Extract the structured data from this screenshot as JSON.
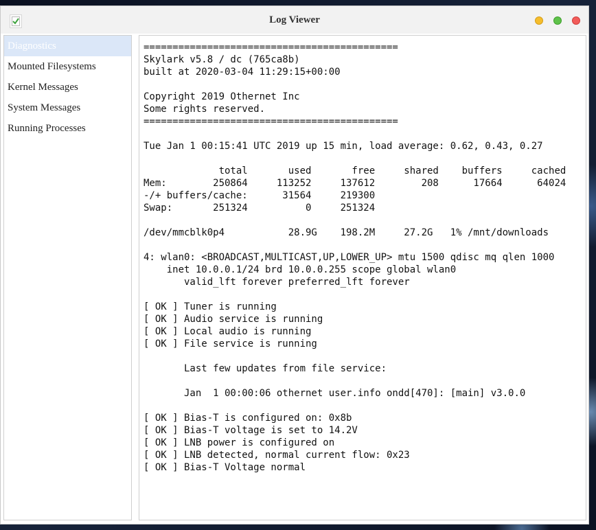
{
  "window": {
    "title": "Log Viewer",
    "accent_colors": {
      "minimize": "#f5bd2c",
      "maximize": "#5fc24a",
      "close": "#f25c5a",
      "selected_nav": "#dbe7f8"
    }
  },
  "sidebar": {
    "items": [
      {
        "label": "Diagnostics",
        "selected": true
      },
      {
        "label": "Mounted Filesystems",
        "selected": false
      },
      {
        "label": "Kernel Messages",
        "selected": false
      },
      {
        "label": "System Messages",
        "selected": false
      },
      {
        "label": "Running Processes",
        "selected": false
      }
    ]
  },
  "log": {
    "lines": [
      "============================================",
      "Skylark v5.8 / dc (765ca8b)",
      "built at 2020-03-04 11:29:15+00:00",
      "",
      "Copyright 2019 Othernet Inc",
      "Some rights reserved.",
      "============================================",
      "",
      "Tue Jan 1 00:15:41 UTC 2019 up 15 min, load average: 0.62, 0.43, 0.27",
      "",
      "             total       used       free     shared    buffers     cached",
      "Mem:        250864     113252     137612        208      17664      64024",
      "-/+ buffers/cache:      31564     219300",
      "Swap:       251324          0     251324",
      "",
      "/dev/mmcblk0p4           28.9G    198.2M     27.2G   1% /mnt/downloads",
      "",
      "4: wlan0: <BROADCAST,MULTICAST,UP,LOWER_UP> mtu 1500 qdisc mq qlen 1000",
      "    inet 10.0.0.1/24 brd 10.0.0.255 scope global wlan0",
      "       valid_lft forever preferred_lft forever",
      "",
      "[ OK ] Tuner is running",
      "[ OK ] Audio service is running",
      "[ OK ] Local audio is running",
      "[ OK ] File service is running",
      "",
      "       Last few updates from file service:",
      "",
      "       Jan  1 00:00:06 othernet user.info ondd[470]: [main] v3.0.0",
      "",
      "[ OK ] Bias-T is configured on: 0x8b",
      "[ OK ] Bias-T voltage is set to 14.2V",
      "[ OK ] LNB power is configured on",
      "[ OK ] LNB detected, normal current flow: 0x23",
      "[ OK ] Bias-T Voltage normal"
    ]
  }
}
